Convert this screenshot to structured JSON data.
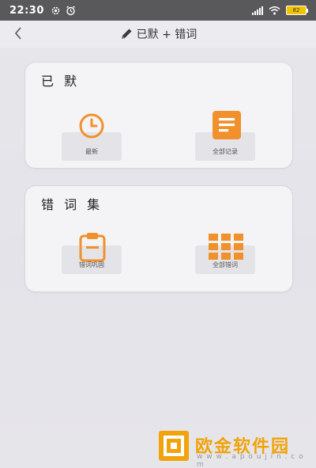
{
  "status_bar": {
    "time": "22:30",
    "battery": "82"
  },
  "nav": {
    "title": "已默 + 错词"
  },
  "cards": [
    {
      "title": "已 默",
      "tiles": [
        {
          "label": "最新",
          "icon": "clock-icon"
        },
        {
          "label": "全部记录",
          "icon": "document-icon"
        }
      ]
    },
    {
      "title": "错 词 集",
      "tiles": [
        {
          "label": "错词巩固",
          "icon": "clipboard-icon"
        },
        {
          "label": "全部错词",
          "icon": "grid-icon"
        }
      ]
    }
  ],
  "colors": {
    "accent": "#f0912c",
    "status_bar": "#59595b"
  },
  "watermark": {
    "name": "欧金软件园",
    "url": "w w w . a p o u j i n . c o m"
  }
}
